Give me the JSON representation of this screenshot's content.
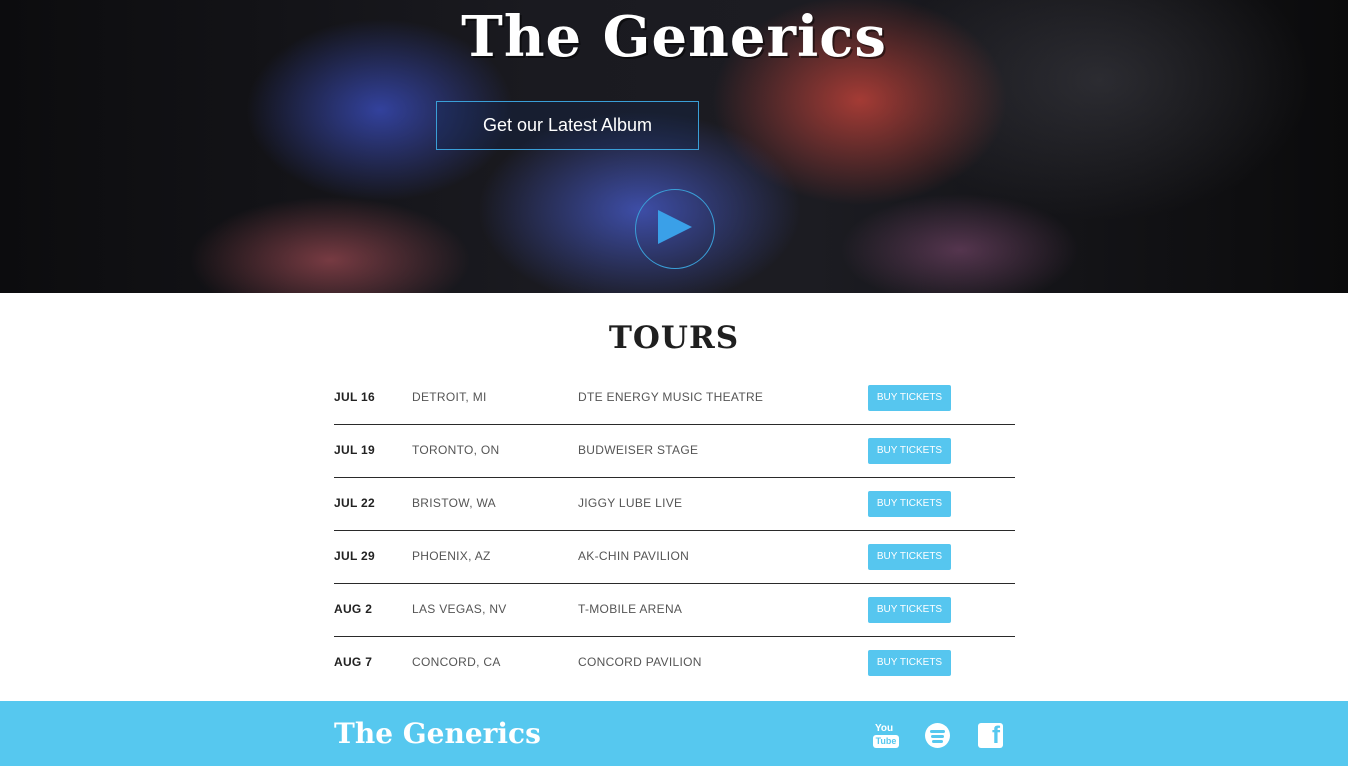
{
  "hero": {
    "title": "The Generics",
    "album_button": "Get our Latest Album"
  },
  "tours": {
    "heading": "TOURS",
    "rows": [
      {
        "date": "JUL 16",
        "city": "DETROIT, MI",
        "venue": "DTE ENERGY MUSIC THEATRE",
        "button": "BUY TICKETS"
      },
      {
        "date": "JUL 19",
        "city": "TORONTO, ON",
        "venue": "BUDWEISER STAGE",
        "button": "BUY TICKETS"
      },
      {
        "date": "JUL 22",
        "city": "BRISTOW, WA",
        "venue": "JIGGY LUBE LIVE",
        "button": "BUY TICKETS"
      },
      {
        "date": "JUL 29",
        "city": "PHOENIX, AZ",
        "venue": "AK-CHIN PAVILION",
        "button": "BUY TICKETS"
      },
      {
        "date": "AUG 2",
        "city": "LAS VEGAS, NV",
        "venue": "T-MOBILE ARENA",
        "button": "BUY TICKETS"
      },
      {
        "date": "AUG 7",
        "city": "CONCORD, CA",
        "venue": "CONCORD PAVILION",
        "button": "BUY TICKETS"
      }
    ]
  },
  "footer": {
    "logo": "The Generics",
    "social": [
      {
        "name": "youtube-icon",
        "label_top": "You",
        "label_box": "Tube"
      },
      {
        "name": "spotify-icon"
      },
      {
        "name": "facebook-icon",
        "glyph": "f"
      }
    ]
  },
  "colors": {
    "accent": "#56c8ef",
    "button_border": "#3a9fd8",
    "play_triangle": "#3aa0e8"
  }
}
